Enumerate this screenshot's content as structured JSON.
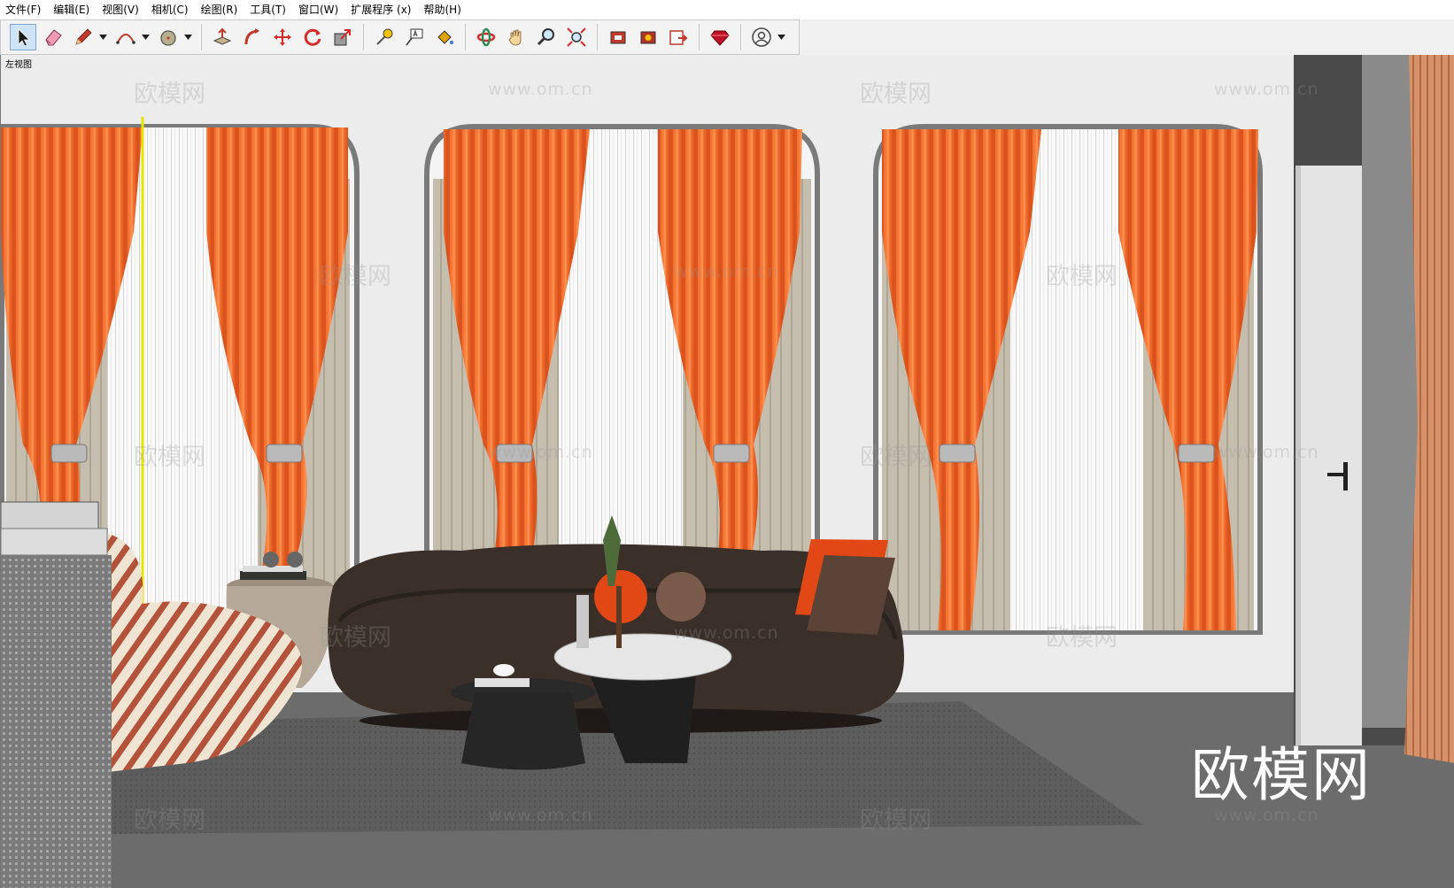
{
  "menu": {
    "items": [
      "文件(F)",
      "编辑(E)",
      "视图(V)",
      "相机(C)",
      "绘图(R)",
      "工具(T)",
      "窗口(W)",
      "扩展程序 (x)",
      "帮助(H)"
    ]
  },
  "toolbar": {
    "tools": [
      {
        "name": "select-tool",
        "icon": "arrow-cursor-icon",
        "active": true
      },
      {
        "name": "eraser-tool",
        "icon": "eraser-icon"
      },
      {
        "name": "pencil-tool",
        "icon": "pencil-icon",
        "dropdown": true
      },
      {
        "name": "arc-tool",
        "icon": "arc-icon",
        "dropdown": true
      },
      {
        "name": "shape-tool",
        "icon": "circle-icon",
        "dropdown": true
      },
      {
        "name": "push-pull-tool",
        "icon": "push-pull-icon"
      },
      {
        "name": "follow-me-tool",
        "icon": "follow-me-icon"
      },
      {
        "name": "move-tool",
        "icon": "move-icon"
      },
      {
        "name": "rotate-tool",
        "icon": "rotate-icon"
      },
      {
        "name": "scale-tool",
        "icon": "scale-icon"
      },
      {
        "name": "tape-measure-tool",
        "icon": "tape-measure-icon"
      },
      {
        "name": "text-tool",
        "icon": "text-label-icon"
      },
      {
        "name": "paint-bucket-tool",
        "icon": "paint-bucket-icon"
      },
      {
        "name": "orbit-tool",
        "icon": "orbit-icon"
      },
      {
        "name": "pan-tool",
        "icon": "hand-icon"
      },
      {
        "name": "zoom-tool",
        "icon": "magnifier-icon"
      },
      {
        "name": "zoom-extents-tool",
        "icon": "zoom-extents-icon"
      },
      {
        "name": "3d-warehouse-tool",
        "icon": "warehouse-icon"
      },
      {
        "name": "extension-warehouse-tool",
        "icon": "extension-icon"
      },
      {
        "name": "send-to-layout-tool",
        "icon": "layout-icon"
      },
      {
        "name": "ruby-console-tool",
        "icon": "ruby-gem-icon"
      },
      {
        "name": "account-tool",
        "icon": "user-account-icon",
        "dropdown": true
      }
    ]
  },
  "viewport": {
    "scene_label": "左视图"
  },
  "watermark": {
    "brand_cn": "欧模网",
    "url": "www.om.cn"
  },
  "colors": {
    "curtain_orange": "#f26f2c",
    "sheer_white": "#f7f7f7",
    "sofa_brown": "#3b3029",
    "floor_gray": "#6a6a6a",
    "selection_yellow": "#e6e600"
  }
}
